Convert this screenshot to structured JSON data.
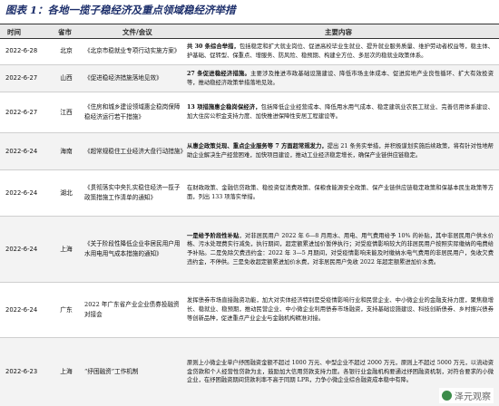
{
  "title": "图表 1：各地一揽子稳经济及重点领域稳经济举措",
  "headers": {
    "date": "时间",
    "province": "省市",
    "file": "文件/会议",
    "content": "主要内容"
  },
  "rows": [
    {
      "date": "2022-6-28",
      "province": "北京",
      "file": "《北京市稳就业专项行动实施方案》",
      "content_bold": "共 30 条综合举措，",
      "content": "包括稳定和扩大就业岗位、促进高校毕业生就业、提升就业服务质量、维护劳动者权益等，稳主体、护基础、促转型、保重点、增服务、防风险、稳预期、构建全方位、多层次的稳就业政策体系。"
    },
    {
      "date": "2022-6-27",
      "province": "山西",
      "file": "《促进稳经济措施落地见效》",
      "content_bold": "27 条促进稳经济措施。",
      "content": "主要涉及推进市政基础设施建设、降低市场主体成本、促进房地产业良性循环、扩大有效投资等，推动稳经济政策举措落地见效。"
    },
    {
      "date": "2022-6-27",
      "province": "江西",
      "file": "《住房和城乡建设领域惠企稳岗保障稳经济运行若干措施》",
      "content_bold": "13 项措施惠企稳岗保经济，",
      "content": "包括降低企业经营成本、降低用水用气成本、稳定建筑业农民工就业、完善信用体系建设、加大住房公积金支持力度、加快推进保障性安居工程建设等。"
    },
    {
      "date": "2022-6-24",
      "province": "海南",
      "file": "《超常规稳住工业经济大盘行动措施》",
      "content_bold": "从惠企政策兑现、重点企业服务等 7 方面超常规发力，",
      "content": "提出 21 条务实举措，并积极谋划实施后续政策，将有针对性地帮助企业解决生产经营困难，加快项目建设，推动工业经济稳定增长，确保产业链供应链稳定。"
    },
    {
      "date": "2022-6-24",
      "province": "湖北",
      "file": "《贯彻落实中央扎实稳住经济一揽子政策措施工作清单的通知》",
      "content_bold": "",
      "content": "在财政政策、金融信贷政策、稳投资促消费政策、保粮食能源安全政策、保产业链供应链稳定政策和保基本民生政策等方面，列出 133 项落实举措。"
    },
    {
      "date": "2022-6-24",
      "province": "上海",
      "file": "《关于阶段性降低企业非居民用户用水用电用气成本措施的通知》",
      "content_bold": "一是给予阶段性补贴",
      "content": "，对非居民用户 2022 年 6—8 月用水、用电、用气费用给予 10% 的补贴，其中非居民用户供水价格、污水处理费实行减免，执行期间，超定额累进加价暂停执行；对受疫情影响较大的非居民用户按照实际缴纳的电费给予补贴。二是免除欠费违约金：2022 年 3—5 月期间，对受疫情影响未能及时缴纳水电气费用的非居民用户，免收欠费违约金，不停供。三是免收超定额累进加价水费，对非居民用户免收 2022 年超定额累进加价水费。"
    },
    {
      "date": "2022-6-24",
      "province": "广东",
      "file": "2022 年广东省产业企业债券投融资对接会",
      "content_bold": "",
      "content": "发挥债券市场直接融资功能，加大对实体经济特别是受疫情影响行业和民营企业、中小微企业的金融支持力度，聚焦稳增长、稳就业、稳预期，推动民营企业、中小微企业利用债券市场融资，支持基础设施建设、科技创新债券、乡村振兴债券等创新品种，促进重点产业企业与金融机构精准对接。"
    },
    {
      "date": "2022-6-23",
      "province": "上海",
      "file": "“纾困融资”工作机制",
      "content_bold": "",
      "content": "原则上小微企业单户纾困融资金额不超过 1000 万元、中型企业不超过 2000 万元，原则上不超过 5000 万元，以流动资金贷款和个人经营性贷款为主，鼓励加大信用贷款支持力度。各银行业金融机构要通过纾困融资机制，对符合要求的小微企业，在纾困融资期间贷款利率不高于同期 LPR，力争小微企业综合融资成本稳中有降。"
    }
  ],
  "watermark": {
    "text": "泽元观察",
    "icon": "wechat-icon"
  }
}
